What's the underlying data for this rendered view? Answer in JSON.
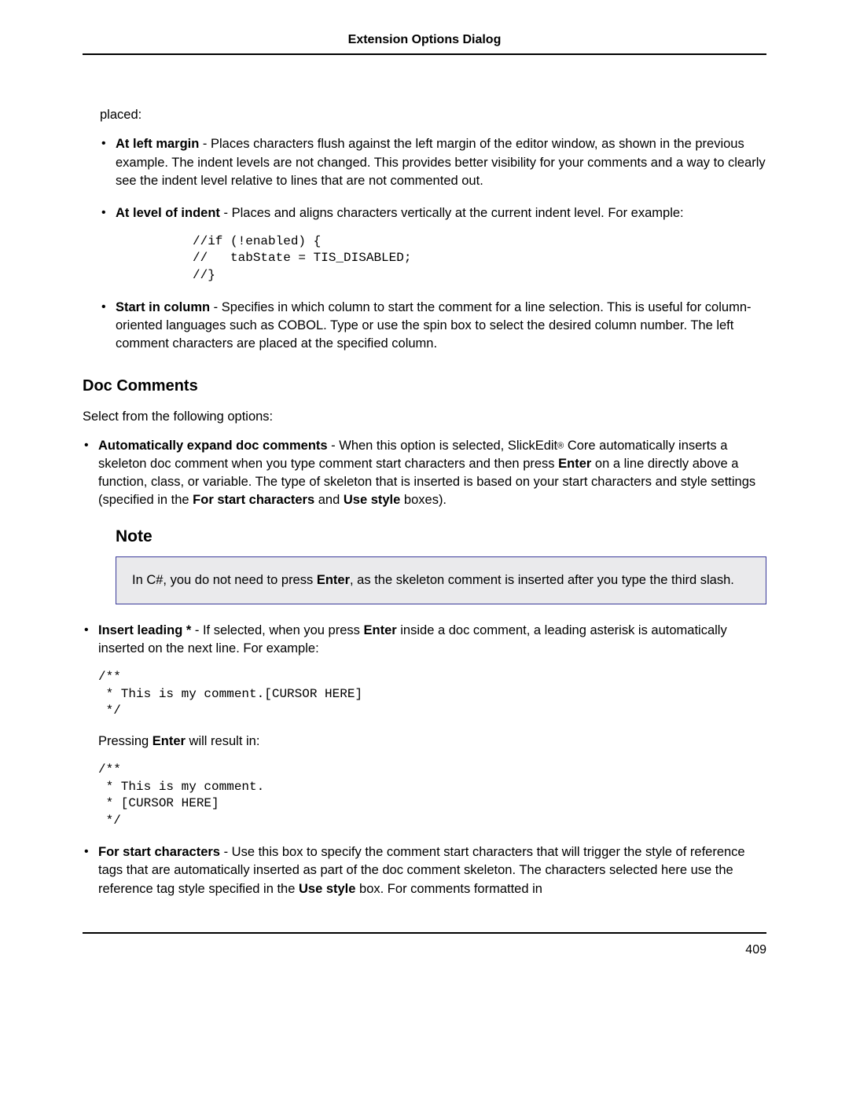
{
  "header": {
    "title": "Extension Options Dialog"
  },
  "lead": "placed:",
  "list1": {
    "i0": {
      "label": "At left margin",
      "text": " - Places characters flush against the left margin of the editor window, as shown in the previous example. The indent levels are not changed. This provides better visibility for your comments and a way to clearly see the indent level relative to lines that are not commented out."
    },
    "i1": {
      "label": "At level of indent",
      "text": " - Places and aligns characters vertically at the current indent level. For example:",
      "code": "//if (!enabled) {\n//   tabState = TIS_DISABLED;\n//}"
    },
    "i2": {
      "label": "Start in column",
      "text": " - Specifies in which column to start the comment for a line selection. This is useful for column-oriented languages such as COBOL. Type or use the spin box to select the desired column number. The left comment characters are placed at the specified column."
    }
  },
  "doc": {
    "heading": "Doc Comments",
    "intro": "Select from the following options:",
    "i0": {
      "label": "Automatically expand doc comments",
      "t1": " - When this option is selected, SlickEdit",
      "reg": "®",
      "t2": " Core automatically inserts a skeleton doc comment when you type comment start characters and then press ",
      "enter": "Enter",
      "t3": " on a line directly above a function, class, or variable. The type of skeleton that is inserted is based on your start characters and style settings (specified in the ",
      "fs": "For start characters",
      "t4": " and ",
      "us": "Use style",
      "t5": " boxes)."
    },
    "note": {
      "heading": "Note",
      "t1": "In C#, you do not need to press ",
      "enter": "Enter",
      "t2": ", as the skeleton comment is inserted after you type the third slash."
    },
    "i1": {
      "label": "Insert leading *",
      "t1": " - If selected, when you press ",
      "enter": "Enter",
      "t2": " inside a doc comment, a leading asterisk is automatically inserted on the next line. For example:",
      "code1": "/**\n * This is my comment.[CURSOR HERE]\n */",
      "mid_a": "Pressing ",
      "mid_enter": "Enter",
      "mid_b": " will result in:",
      "code2": "/**\n * This is my comment.\n * [CURSOR HERE]\n */"
    },
    "i2": {
      "label": "For start characters",
      "t1": " - Use this box to specify the comment start characters that will trigger the style of reference tags that are automatically inserted as part of the doc comment skeleton. The characters selected here use the reference tag style specified in the ",
      "us": "Use style",
      "t2": " box. For comments formatted in"
    }
  },
  "page_number": "409"
}
